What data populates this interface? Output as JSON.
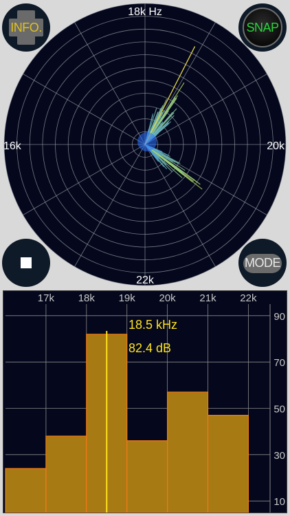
{
  "radar": {
    "labels": {
      "top": "18k Hz",
      "left": "16k",
      "right": "20k",
      "bottom": "22k"
    },
    "colors": {
      "background": "#05081c",
      "grid": "#9aa0aa",
      "label": "#ffffff"
    }
  },
  "buttons": {
    "info": {
      "label": "INFO.",
      "color": "#e0c21e"
    },
    "snap": {
      "label": "SNAP",
      "color": "#27d63a"
    },
    "stop": {
      "icon": "stop-icon"
    },
    "mode": {
      "label": "MODE"
    }
  },
  "spectrum": {
    "readout": {
      "frequency": "18.5 kHz",
      "level": "82.4 dB"
    },
    "marker_frequency_khz": 18.5,
    "colors": {
      "bar_fill": "#a77a13",
      "bar_edge": "#f07a18",
      "marker": "#ffe21e",
      "readout": "#ffe21e",
      "axis_text": "#c8c8c8"
    }
  },
  "chart_data": {
    "type": "bar",
    "title": "",
    "xlabel": "",
    "ylabel": "",
    "x_tick_labels": [
      "17k",
      "18k",
      "19k",
      "20k",
      "21k",
      "22k"
    ],
    "y_tick_labels": [
      "90",
      "70",
      "50",
      "30",
      "10"
    ],
    "y_ticks": [
      90,
      70,
      50,
      30,
      10
    ],
    "ylim": [
      5,
      95
    ],
    "bins_khz": [
      [
        16,
        17
      ],
      [
        17,
        18
      ],
      [
        18,
        19
      ],
      [
        19,
        20
      ],
      [
        20,
        21
      ],
      [
        21,
        22
      ]
    ],
    "values": [
      24,
      38,
      82,
      36,
      57,
      47
    ],
    "grid": true,
    "legend": "none"
  }
}
